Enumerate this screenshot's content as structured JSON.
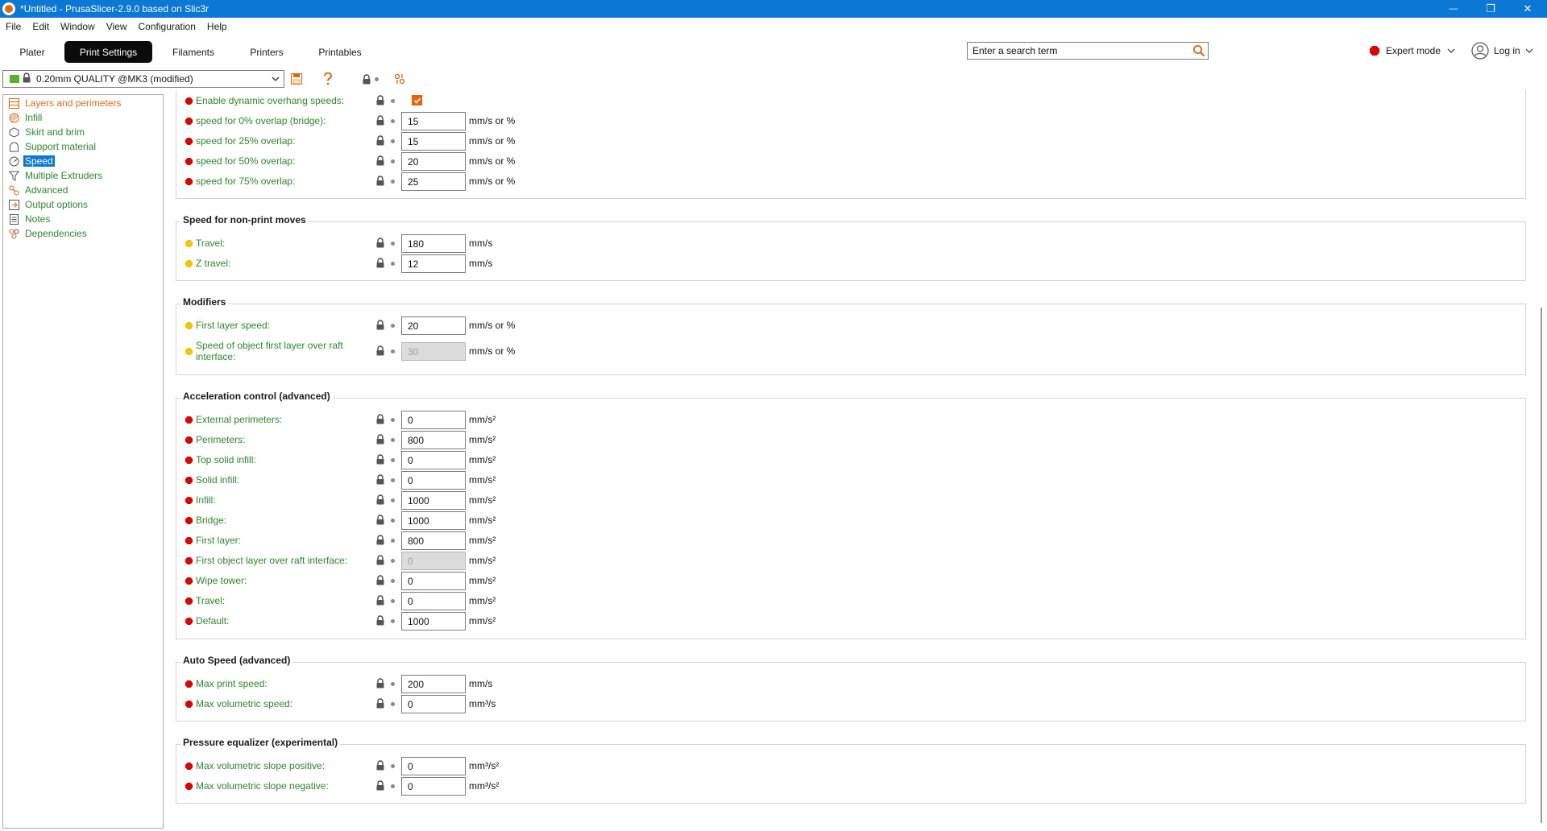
{
  "window": {
    "title": "*Untitled - PrusaSlicer-2.9.0 based on Slic3r",
    "minimize": "—",
    "maximize": "❐",
    "close": "✕"
  },
  "menu": [
    "File",
    "Edit",
    "Window",
    "View",
    "Configuration",
    "Help"
  ],
  "tabs": [
    {
      "label": "Plater",
      "active": false
    },
    {
      "label": "Print Settings",
      "active": true
    },
    {
      "label": "Filaments",
      "active": false
    },
    {
      "label": "Printers",
      "active": false
    },
    {
      "label": "Printables",
      "active": false
    }
  ],
  "search": {
    "placeholder": "Enter a search term"
  },
  "mode": {
    "label": "Expert mode"
  },
  "account": {
    "label": "Log in"
  },
  "preset": {
    "name": "0.20mm QUALITY @MK3 (modified)"
  },
  "colors": {
    "accent": "#0a78d4",
    "expert": "#e00000",
    "simple": "#f5c400",
    "orange": "#ec6b1e",
    "green": "#2e8b2e"
  },
  "sidebar": {
    "items": [
      {
        "label": "Layers and perimeters",
        "icon": "layers-icon",
        "state": "modified"
      },
      {
        "label": "Infill",
        "icon": "infill-icon",
        "state": "normal"
      },
      {
        "label": "Skirt and brim",
        "icon": "skirt-icon",
        "state": "normal"
      },
      {
        "label": "Support material",
        "icon": "support-icon",
        "state": "normal"
      },
      {
        "label": "Speed",
        "icon": "speed-icon",
        "state": "selected"
      },
      {
        "label": "Multiple Extruders",
        "icon": "funnel-icon",
        "state": "normal"
      },
      {
        "label": "Advanced",
        "icon": "advanced-icon",
        "state": "normal"
      },
      {
        "label": "Output options",
        "icon": "output-icon",
        "state": "normal"
      },
      {
        "label": "Notes",
        "icon": "notes-icon",
        "state": "normal"
      },
      {
        "label": "Dependencies",
        "icon": "dependencies-icon",
        "state": "normal"
      }
    ]
  },
  "groups": {
    "overhang": {
      "title": "",
      "rows": [
        {
          "label": "Enable dynamic overhang speeds:",
          "level": "expert",
          "type": "checkbox",
          "checked": true
        },
        {
          "label": "speed for 0% overlap (bridge):",
          "level": "expert",
          "value": "15",
          "unit": "mm/s or %"
        },
        {
          "label": "speed for 25% overlap:",
          "level": "expert",
          "value": "15",
          "unit": "mm/s or %"
        },
        {
          "label": "speed for 50% overlap:",
          "level": "expert",
          "value": "20",
          "unit": "mm/s or %"
        },
        {
          "label": "speed for 75% overlap:",
          "level": "expert",
          "value": "25",
          "unit": "mm/s or %"
        }
      ]
    },
    "nonprint": {
      "title": "Speed for non-print moves",
      "rows": [
        {
          "label": "Travel:",
          "level": "simple",
          "value": "180",
          "unit": "mm/s"
        },
        {
          "label": "Z travel:",
          "level": "simple",
          "value": "12",
          "unit": "mm/s"
        }
      ]
    },
    "modifiers": {
      "title": "Modifiers",
      "rows": [
        {
          "label": "First layer speed:",
          "level": "simple",
          "value": "20",
          "unit": "mm/s or %"
        },
        {
          "label": "Speed of object first layer over raft interface:",
          "level": "simple",
          "value": "30",
          "unit": "mm/s or %",
          "disabled": true,
          "twoLine": true
        }
      ]
    },
    "accel": {
      "title": "Acceleration control (advanced)",
      "rows": [
        {
          "label": "External perimeters:",
          "level": "expert",
          "value": "0",
          "unit": "mm/s²"
        },
        {
          "label": "Perimeters:",
          "level": "expert",
          "value": "800",
          "unit": "mm/s²"
        },
        {
          "label": "Top solid infill:",
          "level": "expert",
          "value": "0",
          "unit": "mm/s²"
        },
        {
          "label": "Solid infill:",
          "level": "expert",
          "value": "0",
          "unit": "mm/s²"
        },
        {
          "label": "Infill:",
          "level": "expert",
          "value": "1000",
          "unit": "mm/s²"
        },
        {
          "label": "Bridge:",
          "level": "expert",
          "value": "1000",
          "unit": "mm/s²"
        },
        {
          "label": "First layer:",
          "level": "expert",
          "value": "800",
          "unit": "mm/s²"
        },
        {
          "label": "First object layer over raft interface:",
          "level": "expert",
          "value": "0",
          "unit": "mm/s²",
          "disabled": true
        },
        {
          "label": "Wipe tower:",
          "level": "expert",
          "value": "0",
          "unit": "mm/s²"
        },
        {
          "label": "Travel:",
          "level": "expert",
          "value": "0",
          "unit": "mm/s²"
        },
        {
          "label": "Default:",
          "level": "expert",
          "value": "1000",
          "unit": "mm/s²"
        }
      ]
    },
    "autospeed": {
      "title": "Auto Speed (advanced)",
      "rows": [
        {
          "label": "Max print speed:",
          "level": "expert",
          "value": "200",
          "unit": "mm/s"
        },
        {
          "label": "Max volumetric speed:",
          "level": "expert",
          "value": "0",
          "unit": "mm³/s"
        }
      ]
    },
    "pressure": {
      "title": "Pressure equalizer (experimental)",
      "rows": [
        {
          "label": "Max volumetric slope positive:",
          "level": "expert",
          "value": "0",
          "unit": "mm³/s²"
        },
        {
          "label": "Max volumetric slope negative:",
          "level": "expert",
          "value": "0",
          "unit": "mm³/s²"
        }
      ]
    }
  }
}
